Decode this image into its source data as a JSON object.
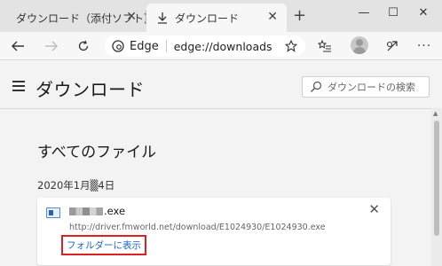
{
  "tabs": [
    {
      "label": "ダウンロード（添付ソフト）",
      "icon": "fujitsu-logo-icon",
      "active": false
    },
    {
      "label": "ダウンロード",
      "icon": "download-arrow-icon",
      "active": true
    }
  ],
  "toolbar": {
    "address_label": "Edge",
    "url": "edge://downloads"
  },
  "page": {
    "title": "ダウンロード",
    "search_placeholder": "ダウンロードの検索",
    "section_title": "すべてのファイル",
    "date_label": "2020年1月▒4日"
  },
  "download_item": {
    "file_name_suffix": ".exe",
    "url": "http://driver.fmworld.net/download/E1024930/E1024930.exe",
    "action_label": "フォルダーに表示"
  },
  "colors": {
    "accent": "#1a66c4",
    "highlight_box": "#e02020",
    "fujitsu_red": "#e60012"
  }
}
